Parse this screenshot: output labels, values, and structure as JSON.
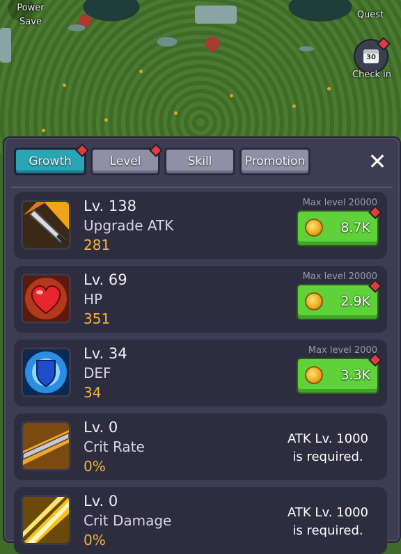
{
  "hud": {
    "power_save_line1": "Power",
    "power_save_line2": "Save",
    "quest_label": "Quest",
    "checkin_label": "Check in",
    "checkin_day": "30"
  },
  "tabs": [
    {
      "label": "Growth",
      "active": true,
      "badge": true
    },
    {
      "label": "Level",
      "active": false,
      "badge": true
    },
    {
      "label": "Skill",
      "active": false,
      "badge": false
    },
    {
      "label": "Promotion",
      "active": false,
      "badge": false
    }
  ],
  "close_symbol": "✕",
  "stats": [
    {
      "level": "Lv. 138",
      "name": "Upgrade ATK",
      "value": "281",
      "max_level": "Max level 20000",
      "cost": "8.7K",
      "icon": "sword-icon"
    },
    {
      "level": "Lv. 69",
      "name": "HP",
      "value": "351",
      "max_level": "Max level 20000",
      "cost": "2.9K",
      "icon": "heart-icon"
    },
    {
      "level": "Lv. 34",
      "name": "DEF",
      "value": "34",
      "max_level": "Max level 2000",
      "cost": "3.3K",
      "icon": "shield-icon"
    },
    {
      "level": "Lv. 0",
      "name": "Crit Rate",
      "value": "0%",
      "requirement_line1": "ATK Lv. 1000",
      "requirement_line2": "is required.",
      "icon": "crit-blade-icon"
    },
    {
      "level": "Lv. 0",
      "name": "Crit Damage",
      "value": "0%",
      "requirement_line1": "ATK Lv. 1000",
      "requirement_line2": "is required.",
      "icon": "crit-burst-icon"
    }
  ],
  "colors": {
    "accent_tab": "#2aa5b4",
    "buy_button": "#5fd13b",
    "value_text": "#f0b63a"
  }
}
